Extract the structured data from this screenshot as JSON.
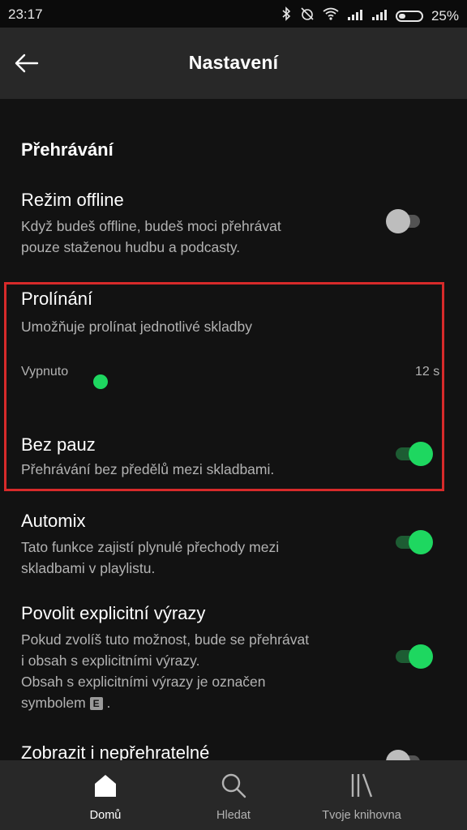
{
  "status_bar": {
    "time": "23:17",
    "battery": "25%",
    "icons": [
      "bluetooth-icon",
      "alarm-off-icon",
      "wifi-icon",
      "signal-icon",
      "signal-icon",
      "battery-icon"
    ]
  },
  "header": {
    "title": "Nastavení",
    "back_icon": "arrow-left-icon"
  },
  "section": {
    "title": "Přehrávání"
  },
  "settings": {
    "offline": {
      "title": "Režim offline",
      "desc_line1": "Když budeš offline, budeš moci přehrávat",
      "desc_line2": "pouze staženou hudbu a podcasty.",
      "enabled": false
    },
    "crossfade": {
      "title": "Prolínání",
      "desc": "Umožňuje prolínat jednotlivé skladby",
      "min_label": "Vypnuto",
      "max_label": "12 s",
      "value_fraction": 0.0
    },
    "gapless": {
      "title": "Bez pauz",
      "desc": "Přehrávání bez předělů mezi skladbami.",
      "enabled": true
    },
    "automix": {
      "title": "Automix",
      "desc_line1": "Tato funkce zajistí plynulé přechody mezi",
      "desc_line2": "skladbami v playlistu.",
      "enabled": true
    },
    "explicit": {
      "title": "Povolit explicitní výrazy",
      "desc_line1": "Pokud zvolíš tuto možnost, bude se přehrávat",
      "desc_line2": "i obsah s explicitními výrazy.",
      "desc_line3": "Obsah s explicitními výrazy je označen",
      "desc_line4_prefix": "symbolem",
      "desc_badge": "E",
      "desc_line4_suffix": ".",
      "enabled": true
    },
    "unplayable": {
      "title": "Zobrazit i nepřehratelné",
      "enabled": false
    }
  },
  "bottom_nav": {
    "home": "Domů",
    "search": "Hledat",
    "library": "Tvoje knihovna"
  },
  "colors": {
    "accent": "#1ed760",
    "highlight_border": "#d72a2a",
    "background": "#121212",
    "header_bg": "#282828"
  }
}
